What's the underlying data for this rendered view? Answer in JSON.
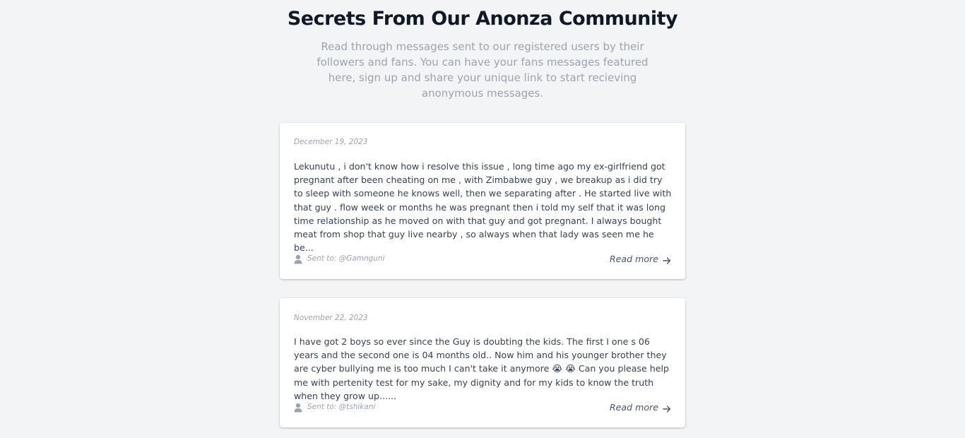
{
  "header": {
    "title": "Secrets From Our Anonza Community",
    "subtitle": "Read through messages sent to our registered users by their followers and fans. You can have your fans messages featured here, sign up and share your unique link to start recieving anonymous messages."
  },
  "posts": [
    {
      "date": "December 19, 2023",
      "message": "Lekunutu , i don't know how i resolve this issue , long time ago my ex-girlfriend got pregnant after been cheating on me , with Zimbabwe guy , we breakup as i did try to sleep with someone he knows well, then we separating after . He started live with that guy . flow week or months he was pregnant then i told my self that it was long time relationship as he moved on with that guy and got pregnant. I always bought meat from shop that guy live nearby , so always when that lady was seen me he be...",
      "sent_to": "Sent to: @Gamnguni",
      "read_more": "Read more",
      "icons": {
        "user": "user-icon",
        "arrow": "arrow-right-icon"
      }
    },
    {
      "date": "November 22, 2023",
      "message": "I have got 2 boys so ever since the Guy is doubting the kids. The first I one s 06 years and the second one is 04 months old.. Now him and his younger brother they are cyber bullying me is too much I can't take it anymore 😭 😭 Can you please help me with pertenity test for my sake, my dignity and for my kids to know the truth when they grow up......",
      "sent_to": "Sent to: @tshikani",
      "read_more": "Read more",
      "icons": {
        "user": "user-icon",
        "arrow": "arrow-right-icon"
      }
    }
  ],
  "colors": {
    "background": "#f3f4f6",
    "card": "#ffffff",
    "title": "#111827",
    "muted": "#9ca3af",
    "body_text": "#374151",
    "link": "#4b5563"
  }
}
